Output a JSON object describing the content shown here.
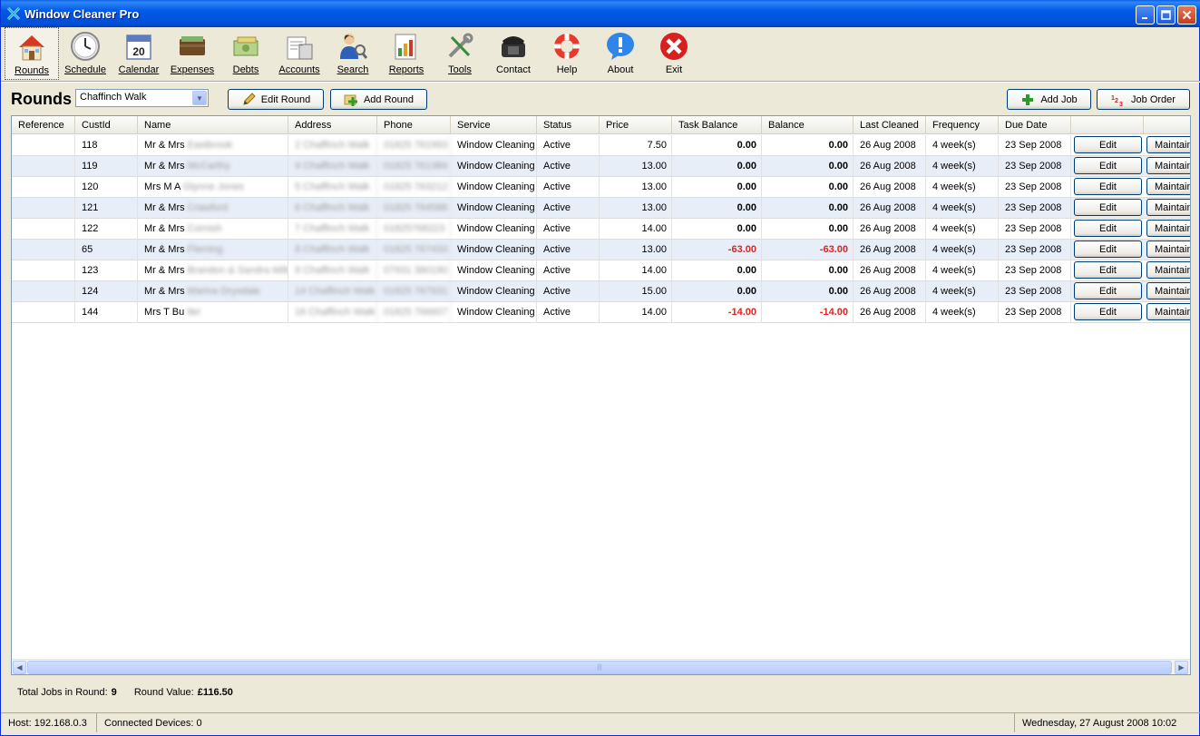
{
  "window": {
    "title": "Window Cleaner Pro"
  },
  "toolbar": [
    {
      "id": "rounds",
      "label": "Rounds",
      "icon": "house-icon"
    },
    {
      "id": "schedule",
      "label": "Schedule",
      "icon": "clock-icon"
    },
    {
      "id": "calendar",
      "label": "Calendar",
      "icon": "calendar-icon"
    },
    {
      "id": "expenses",
      "label": "Expenses",
      "icon": "wallet-icon"
    },
    {
      "id": "debts",
      "label": "Debts",
      "icon": "money-icon"
    },
    {
      "id": "accounts",
      "label": "Accounts",
      "icon": "ledger-icon"
    },
    {
      "id": "search",
      "label": "Search",
      "icon": "people-search-icon"
    },
    {
      "id": "reports",
      "label": "Reports",
      "icon": "chart-icon"
    },
    {
      "id": "tools",
      "label": "Tools",
      "icon": "tools-icon"
    },
    {
      "id": "contact",
      "label": "Contact",
      "icon": "phone-icon"
    },
    {
      "id": "help",
      "label": "Help",
      "icon": "lifebuoy-icon"
    },
    {
      "id": "about",
      "label": "About",
      "icon": "info-icon"
    },
    {
      "id": "exit",
      "label": "Exit",
      "icon": "exit-icon"
    }
  ],
  "rounds": {
    "title": "Rounds",
    "selected_round": "Chaffinch Walk",
    "edit_round_label": "Edit Round",
    "add_round_label": "Add Round",
    "add_job_label": "Add Job",
    "job_order_label": "Job Order"
  },
  "grid": {
    "columns": [
      "Reference",
      "CustId",
      "Name",
      "Address",
      "Phone",
      "Service",
      "Status",
      "Price",
      "Task Balance",
      "Balance",
      "Last Cleaned",
      "Frequency",
      "Due Date",
      "",
      ""
    ],
    "rows": [
      {
        "reference": "",
        "custid": "118",
        "name": "Mr & Mrs",
        "name_rest": "Eastbrook",
        "address": "2 Chaffinch Walk",
        "phone": "01825 761993",
        "service": "Window Cleaning",
        "status": "Active",
        "price": "7.50",
        "task_balance": "0.00",
        "balance": "0.00",
        "last_cleaned": "26 Aug 2008",
        "frequency": "4 week(s)",
        "due_date": "23 Sep 2008",
        "edit": "Edit",
        "maint": "Maintain"
      },
      {
        "reference": "",
        "custid": "119",
        "name": "Mr & Mrs",
        "name_rest": "McCarthy",
        "address": "4 Chaffinch Walk",
        "phone": "01825 761384",
        "service": "Window Cleaning",
        "status": "Active",
        "price": "13.00",
        "task_balance": "0.00",
        "balance": "0.00",
        "last_cleaned": "26 Aug 2008",
        "frequency": "4 week(s)",
        "due_date": "23 Sep 2008",
        "edit": "Edit",
        "maint": "Maintain"
      },
      {
        "reference": "",
        "custid": "120",
        "name": "Mrs M A",
        "name_rest": "Glynne Jones",
        "address": "5 Chaffinch Walk",
        "phone": "01825 763212",
        "service": "Window Cleaning",
        "status": "Active",
        "price": "13.00",
        "task_balance": "0.00",
        "balance": "0.00",
        "last_cleaned": "26 Aug 2008",
        "frequency": "4 week(s)",
        "due_date": "23 Sep 2008",
        "edit": "Edit",
        "maint": "Maintain"
      },
      {
        "reference": "",
        "custid": "121",
        "name": "Mr & Mrs",
        "name_rest": "Crawford",
        "address": "6 Chaffinch Walk",
        "phone": "01825 764588",
        "service": "Window Cleaning",
        "status": "Active",
        "price": "13.00",
        "task_balance": "0.00",
        "balance": "0.00",
        "last_cleaned": "26 Aug 2008",
        "frequency": "4 week(s)",
        "due_date": "23 Sep 2008",
        "edit": "Edit",
        "maint": "Maintain"
      },
      {
        "reference": "",
        "custid": "122",
        "name": "Mr & Mrs",
        "name_rest": "Cornish",
        "address": "7 Chaffinch Walk",
        "phone": "01825768223",
        "service": "Window Cleaning",
        "status": "Active",
        "price": "14.00",
        "task_balance": "0.00",
        "balance": "0.00",
        "last_cleaned": "26 Aug 2008",
        "frequency": "4 week(s)",
        "due_date": "23 Sep 2008",
        "edit": "Edit",
        "maint": "Maintain"
      },
      {
        "reference": "",
        "custid": "65",
        "name": "Mr & Mrs",
        "name_rest": "Fleming",
        "address": "8 Chaffinch Walk",
        "phone": "01825 767433",
        "service": "Window Cleaning",
        "status": "Active",
        "price": "13.00",
        "task_balance": "-63.00",
        "balance": "-63.00",
        "last_cleaned": "26 Aug 2008",
        "frequency": "4 week(s)",
        "due_date": "23 Sep 2008",
        "edit": "Edit",
        "maint": "Maintain"
      },
      {
        "reference": "",
        "custid": "123",
        "name": "Mr & Mrs",
        "name_rest": "Brandon & Sandra Mills",
        "address": "9 Chaffinch Walk",
        "phone": "07931 380190",
        "service": "Window Cleaning",
        "status": "Active",
        "price": "14.00",
        "task_balance": "0.00",
        "balance": "0.00",
        "last_cleaned": "26 Aug 2008",
        "frequency": "4 week(s)",
        "due_date": "23 Sep 2008",
        "edit": "Edit",
        "maint": "Maintain"
      },
      {
        "reference": "",
        "custid": "124",
        "name": "Mr & Mrs",
        "name_rest": "Marina Drysdale",
        "address": "14 Chaffinch Walk",
        "phone": "01825 767931",
        "service": "Window Cleaning",
        "status": "Active",
        "price": "15.00",
        "task_balance": "0.00",
        "balance": "0.00",
        "last_cleaned": "26 Aug 2008",
        "frequency": "4 week(s)",
        "due_date": "23 Sep 2008",
        "edit": "Edit",
        "maint": "Maintain"
      },
      {
        "reference": "",
        "custid": "144",
        "name": "Mrs T Bu",
        "name_rest": "tler",
        "address": "16 Chaffinch Walk",
        "phone": "01825 766607",
        "service": "Window Cleaning",
        "status": "Active",
        "price": "14.00",
        "task_balance": "-14.00",
        "balance": "-14.00",
        "last_cleaned": "26 Aug 2008",
        "frequency": "4 week(s)",
        "due_date": "23 Sep 2008",
        "edit": "Edit",
        "maint": "Maintain"
      }
    ]
  },
  "summary": {
    "total_jobs_label": "Total Jobs in Round:",
    "total_jobs_value": "9",
    "round_value_label": "Round Value:",
    "round_value_value": "£116.50"
  },
  "statusbar": {
    "host": "Host: 192.168.0.3",
    "devices": "Connected Devices: 0",
    "datetime": "Wednesday, 27 August 2008 10:02"
  },
  "colors": {
    "title_bar": "#0054e3",
    "negative": "#e0211f",
    "alt_row": "#e8eef8"
  }
}
